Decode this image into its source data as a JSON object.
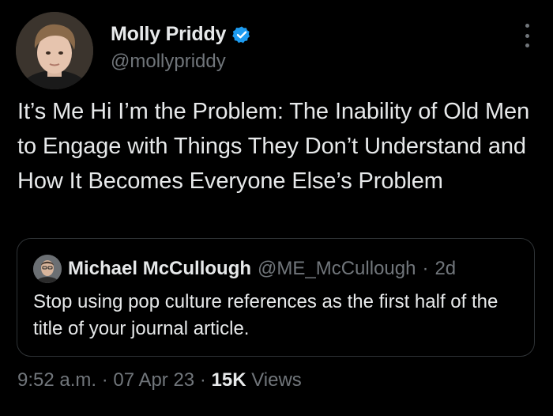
{
  "author": {
    "name": "Molly Priddy",
    "handle": "@mollypriddy",
    "verified": true
  },
  "tweet": {
    "text": "It’s Me Hi I’m the Problem: The Inability of Old Men to Engage with Things They Don’t Understand and How It Becomes Everyone Else’s Problem"
  },
  "quoted": {
    "name": "Michael McCullough",
    "handle": "@ME_McCullough",
    "separator": "·",
    "time": "2d",
    "text": "Stop using pop culture references as the first half of the title of your journal article."
  },
  "meta": {
    "time": "9:52 a.m.",
    "sep1": "·",
    "date": "07 Apr 23",
    "sep2": "·",
    "views_count": "15K",
    "views_label": "Views"
  },
  "colors": {
    "background": "#000000",
    "text_primary": "#e7e9ea",
    "text_secondary": "#71767b",
    "verified_badge": "#1d9bf0",
    "quote_border": "#2f3336"
  },
  "icons": {
    "verified": "verified-badge-icon",
    "more": "more-options-icon"
  }
}
